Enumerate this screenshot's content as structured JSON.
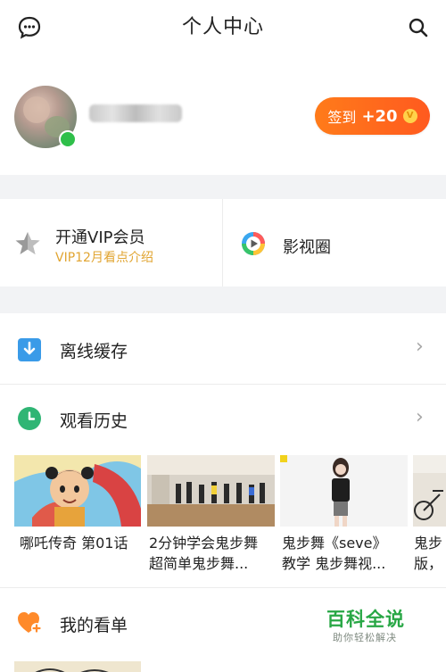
{
  "header": {
    "title": "个人中心",
    "left_icon": "message-icon",
    "right_icon": "search-icon"
  },
  "profile": {
    "signin_label": "签到",
    "signin_points": "+20",
    "coin_symbol": "V",
    "accent": "#ff6a1f"
  },
  "cards": {
    "vip_title": "开通VIP会员",
    "vip_subtitle": "VIP12月看点介绍",
    "film_title": "影视圈",
    "vip_icon": "star-icon",
    "film_icon": "play-circle-icon"
  },
  "menu": {
    "offline_cache": "离线缓存",
    "watch_history": "观看历史",
    "my_list": "我的看单",
    "chevron": "›"
  },
  "history": [
    {
      "line1": "哪吒传奇 第01话",
      "line2": ""
    },
    {
      "line1": "2分钟学会鬼步舞",
      "line2": "超简单鬼步舞..."
    },
    {
      "line1": "鬼步舞《seve》",
      "line2": "教学 鬼步舞视..."
    },
    {
      "line1": "鬼步",
      "line2": "版，"
    }
  ],
  "watermark": {
    "main": "百科全说",
    "sub": "助你轻松解决"
  }
}
